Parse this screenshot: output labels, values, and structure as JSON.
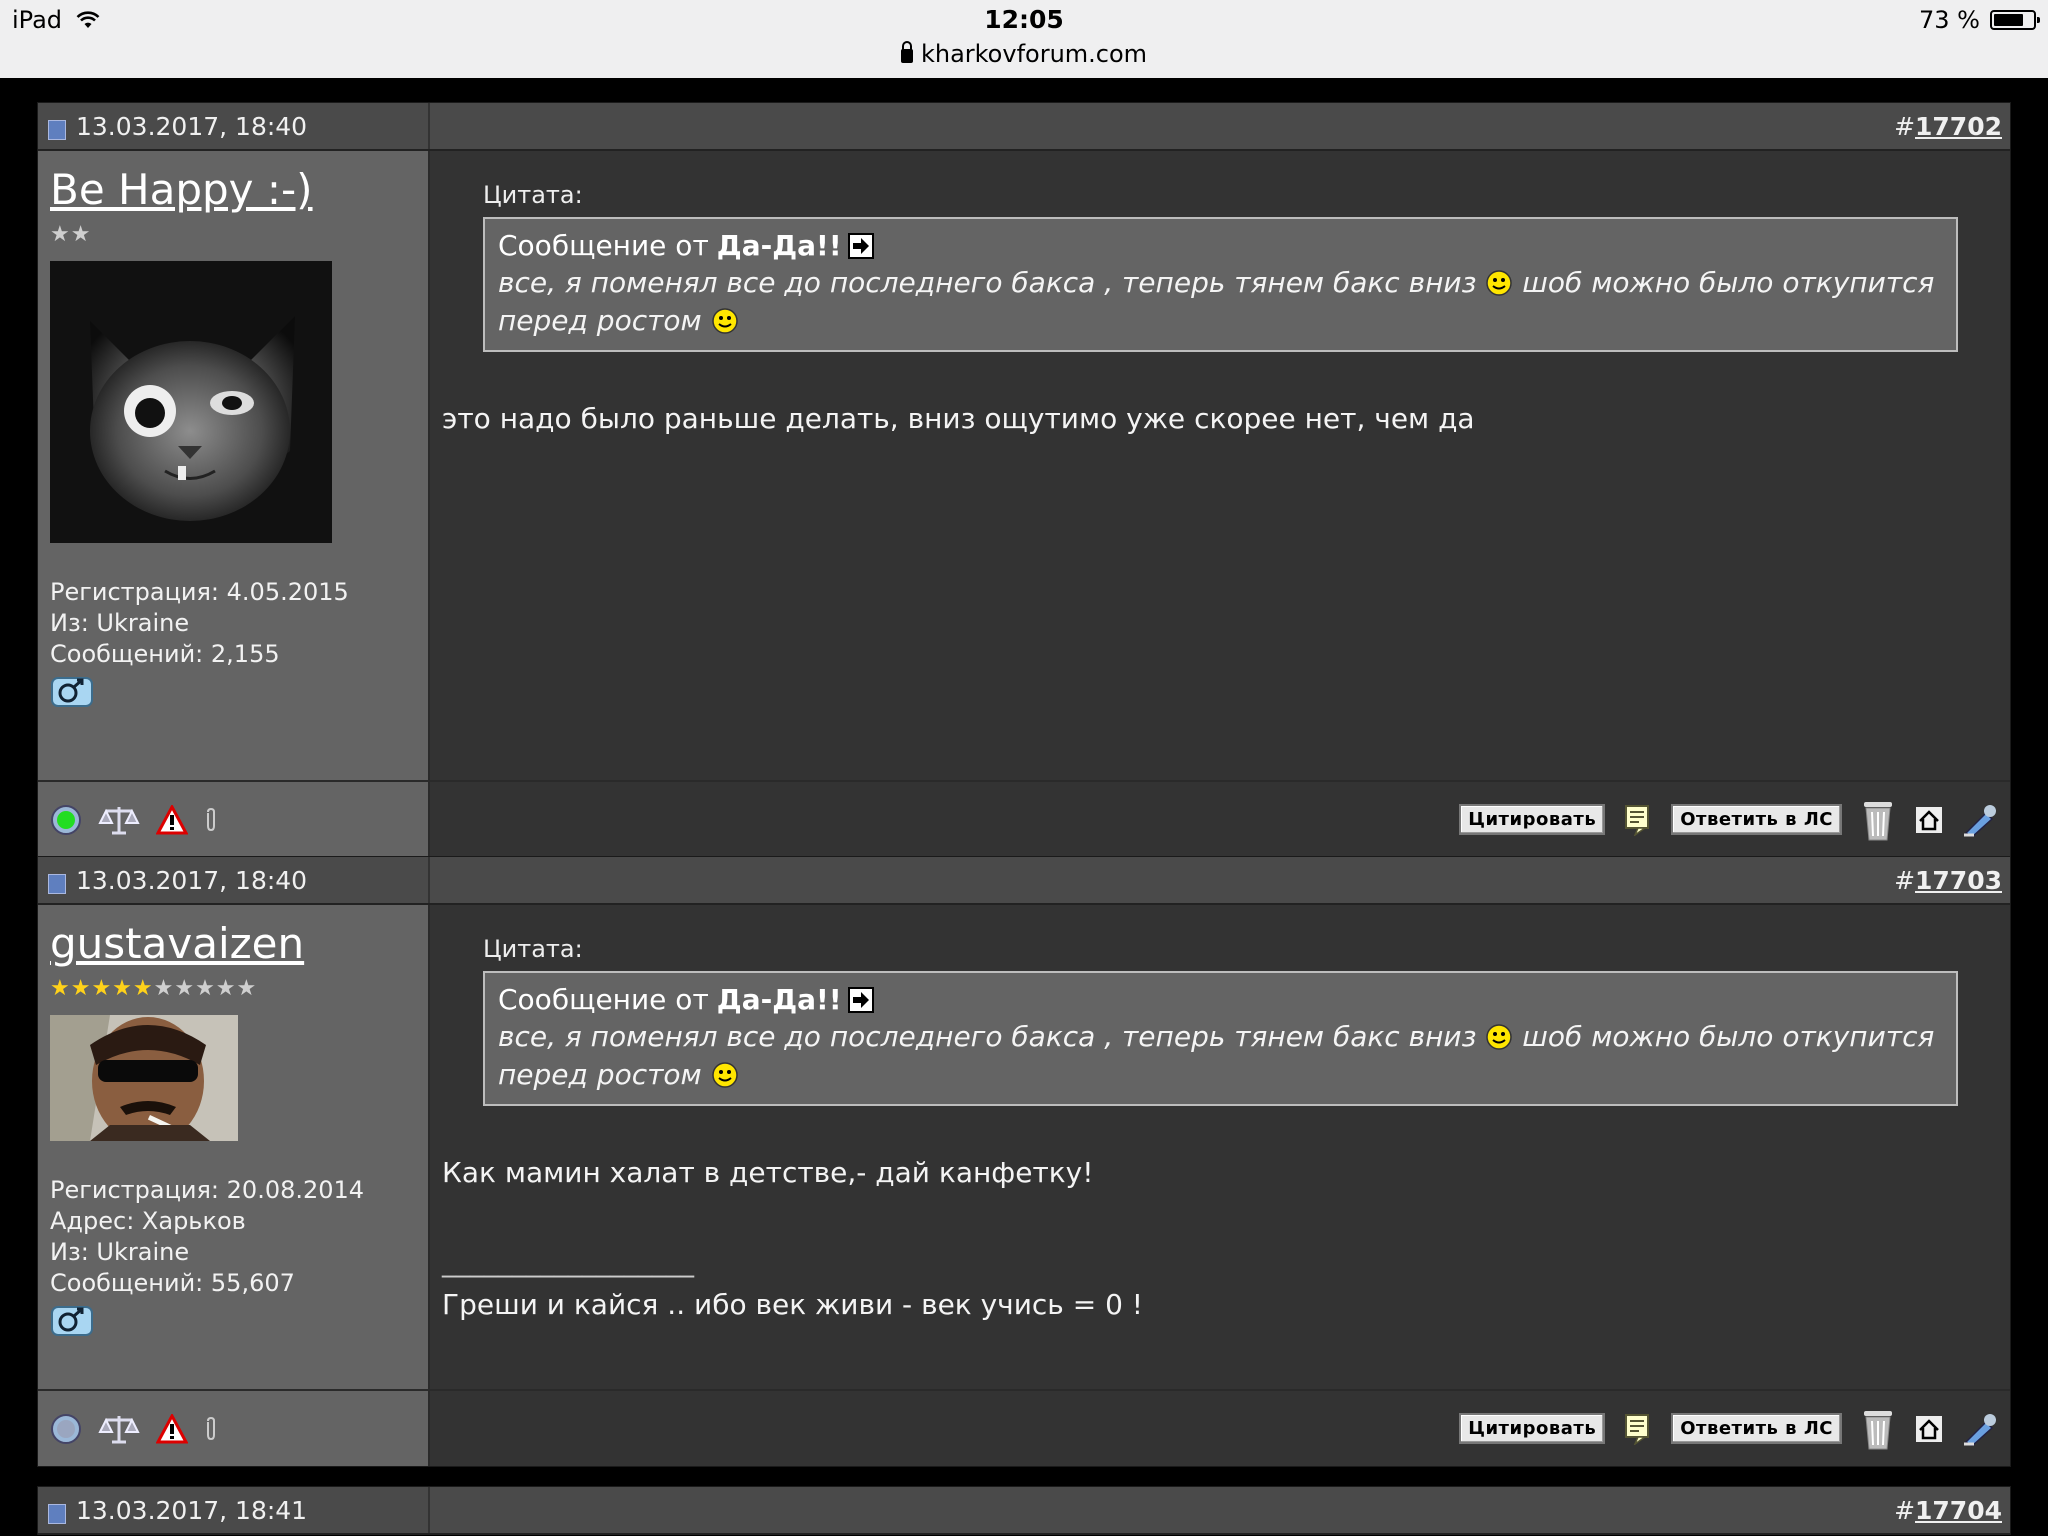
{
  "status_bar": {
    "device": "iPad",
    "time": "12:05",
    "battery": "73 %",
    "url": "kharkovforum.com"
  },
  "posts": [
    {
      "date": "13.03.2017, 18:40",
      "hash": "#",
      "number": "17702",
      "username": "Be Happy :-)",
      "stars_on": 0,
      "stars_total": 2,
      "meta": [
        "Регистрация: 4.05.2015",
        "Из: Ukraine",
        "Сообщений: 2,155"
      ],
      "quote_label": "Цитата:",
      "quote_prefix": "Сообщение от",
      "quote_author": "Да-Да!!",
      "quote_text_1": "все, я поменял все до последнего бакса , теперь тянем бакс вниз",
      "quote_text_2": "шоб можно было откупится перед ростом",
      "message": "это надо было раньше делать, вниз ощутимо уже скорее нет, чем да",
      "quote_button": "Цитировать",
      "pm_button": "Ответить в ЛС"
    },
    {
      "date": "13.03.2017, 18:40",
      "hash": "#",
      "number": "17703",
      "username": "gustavaizen",
      "stars_on": 5,
      "stars_total": 10,
      "meta": [
        "Регистрация: 20.08.2014",
        "Адрес: Харьков",
        "Из: Ukraine",
        "Сообщений: 55,607"
      ],
      "quote_label": "Цитата:",
      "quote_prefix": "Сообщение от",
      "quote_author": "Да-Да!!",
      "quote_text_1": "все, я поменял все до последнего бакса , теперь тянем бакс вниз",
      "quote_text_2": "шоб можно было откупится перед ростом",
      "message": "Как мамин халат в детстве,- дай канфетку!",
      "signature_line": "__________________",
      "signature": "Греши и кайся .. ибо век живи - век учись = 0 !",
      "quote_button": "Цитировать",
      "pm_button": "Ответить в ЛС"
    },
    {
      "date": "13.03.2017, 18:41",
      "hash": "#",
      "number": "17704"
    }
  ]
}
